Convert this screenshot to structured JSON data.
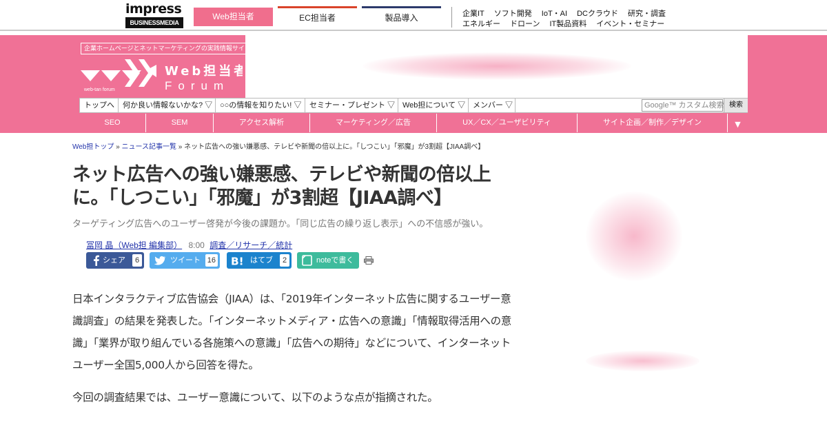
{
  "topbar": {
    "logo_word": "impress",
    "logo_sub": "BUSINESSMEDIA",
    "product_tabs": [
      "Web担当者",
      "EC担当者",
      "製品導入"
    ],
    "categories_row1": [
      "企業IT",
      "ソフト開発",
      "IoT・AI",
      "DCクラウド",
      "研究・調査"
    ],
    "categories_row2": [
      "エネルギー",
      "ドローン",
      "IT製品資料",
      "イベント・セミナー"
    ]
  },
  "header": {
    "tagline": "企業ホームページとネットマーケティングの実践情報サイト",
    "logo_title": "Web担当者",
    "logo_forum": "Forum",
    "logo_small": "web-tan forum",
    "brand_color": "#f07196"
  },
  "nav1": {
    "items": [
      "トップへ",
      "何か良い情報ないかな? ▽",
      "○○の情報を知りたい! ▽",
      "セミナー・プレゼント ▽",
      "Web担について ▽",
      "メンバー ▽"
    ],
    "search_placeholder": "Google™ カスタム検索",
    "search_button": "検索"
  },
  "nav2": {
    "items": [
      "SEO",
      "SEM",
      "アクセス解析",
      "マーケティング／広告",
      "UX／CX／ユーザビリティ",
      "サイト企画／制作／デザイン"
    ],
    "more": "▼"
  },
  "breadcrumb": {
    "items": [
      "Web担トップ",
      "ニュース記事一覧"
    ],
    "sep": "»",
    "current": "ネット広告への強い嫌悪感、テレビや新聞の倍以上に。「しつこい」「邪魔」が3割超【JIAA調べ】"
  },
  "article": {
    "headline": "ネット広告への強い嫌悪感、テレビや新聞の倍以上に。「しつこい」「邪魔」が3割超【JIAA調べ】",
    "subtitle": "ターゲティング広告へのユーザー啓発が今後の課題か。「同じ広告の繰り返し表示」への不信感が強い。",
    "author": "冨岡 晶（Web担 編集部）",
    "time": "8:00",
    "category": "調査／リサーチ／統計",
    "para1": "日本インタラクティブ広告協会（JIAA）は、「2019年インターネット広告に関するユーザー意識調査」の結果を発表した。「インターネットメディア・広告への意識」「情報取得活用への意識」「業界が取り組んでいる各施策への意識」「広告への期待」などについて、インターネットユーザー全国5,000人から回答を得た。",
    "para2": "今回の調査結果では、ユーザー意識について、以下のような点が指摘された。"
  },
  "share": {
    "facebook": {
      "label": "シェア",
      "count": "6",
      "color": "#3b5998"
    },
    "twitter": {
      "label": "ツイート",
      "count": "16",
      "color": "#55acee"
    },
    "hatena": {
      "label": "はてブ",
      "count": "2",
      "color": "#1b83cd"
    },
    "note": {
      "label": "noteで書く",
      "color": "#3dbb9c"
    }
  }
}
